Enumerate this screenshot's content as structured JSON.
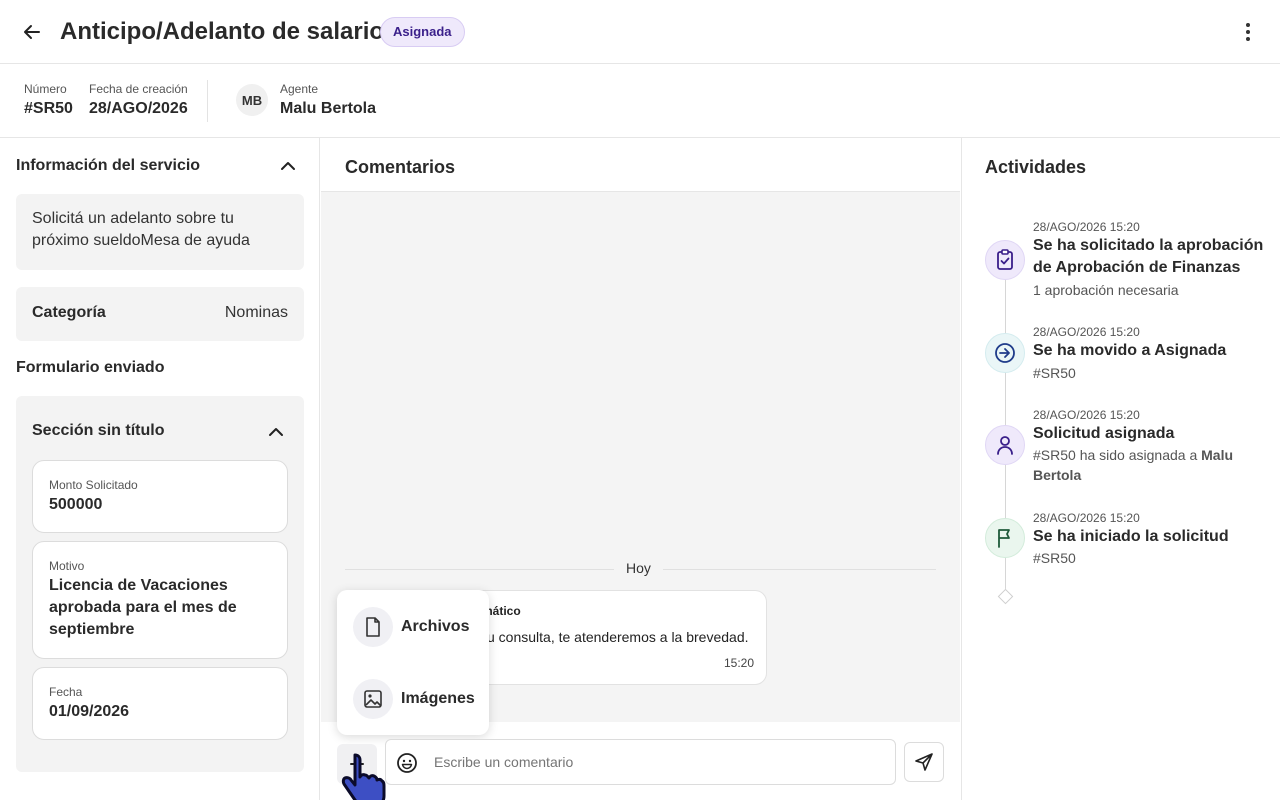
{
  "header": {
    "title": "Anticipo/Adelanto de salario",
    "status": "Asignada"
  },
  "meta": {
    "number_label": "Número",
    "number_value": "#SR50",
    "date_label": "Fecha de creación",
    "date_value": "28/AGO/2026",
    "agent_initials": "MB",
    "agent_label": "Agente",
    "agent_name": "Malu Bertola"
  },
  "service_info": {
    "title": "Información del servicio",
    "description": "Solicitá un adelanto sobre tu próximo sueldoMesa de ayuda",
    "category_label": "Categoría",
    "category_value": "Nominas",
    "form_title": "Formulario enviado",
    "section_title": "Sección sin título",
    "fields": [
      {
        "label": "Monto Solicitado",
        "value": "500000"
      },
      {
        "label": "Motivo",
        "value": "Licencia de Vacaciones aprobada para el mes de septiembre"
      },
      {
        "label": "Fecha",
        "value": "01/09/2026"
      }
    ]
  },
  "comments": {
    "title": "Comentarios",
    "day_separator": "Hoy",
    "message_author": "mático",
    "message_text": "u consulta, te atenderemos a la brevedad.",
    "message_time": "15:20",
    "attach_menu": [
      {
        "label": "Archivos",
        "icon": "file-icon"
      },
      {
        "label": "Imágenes",
        "icon": "image-icon"
      }
    ],
    "placeholder": "Escribe un comentario"
  },
  "activities": {
    "title": "Actividades",
    "items": [
      {
        "time": "28/AGO/2026 15:20",
        "title": "Se ha solicitado la aprobación de Aprobación de Finanzas",
        "sub": "1 aprobación necesaria",
        "icon": "clipboard-check-icon"
      },
      {
        "time": "28/AGO/2026 15:20",
        "title": "Se ha movido a Asignada",
        "sub": "#SR50",
        "icon": "arrow-circle-icon"
      },
      {
        "time": "28/AGO/2026 15:20",
        "title": "Solicitud asignada",
        "sub_prefix": "#SR50 ha sido asignada a ",
        "sub_strong": "Malu Bertola",
        "icon": "user-icon"
      },
      {
        "time": "28/AGO/2026 15:20",
        "title": "Se ha iniciado la solicitud",
        "sub": "#SR50",
        "icon": "flag-icon"
      }
    ]
  },
  "colors": {
    "accent": "#3a1f8a",
    "badge_bg": "#efe9fb",
    "cursor": "#3d4fc4"
  }
}
